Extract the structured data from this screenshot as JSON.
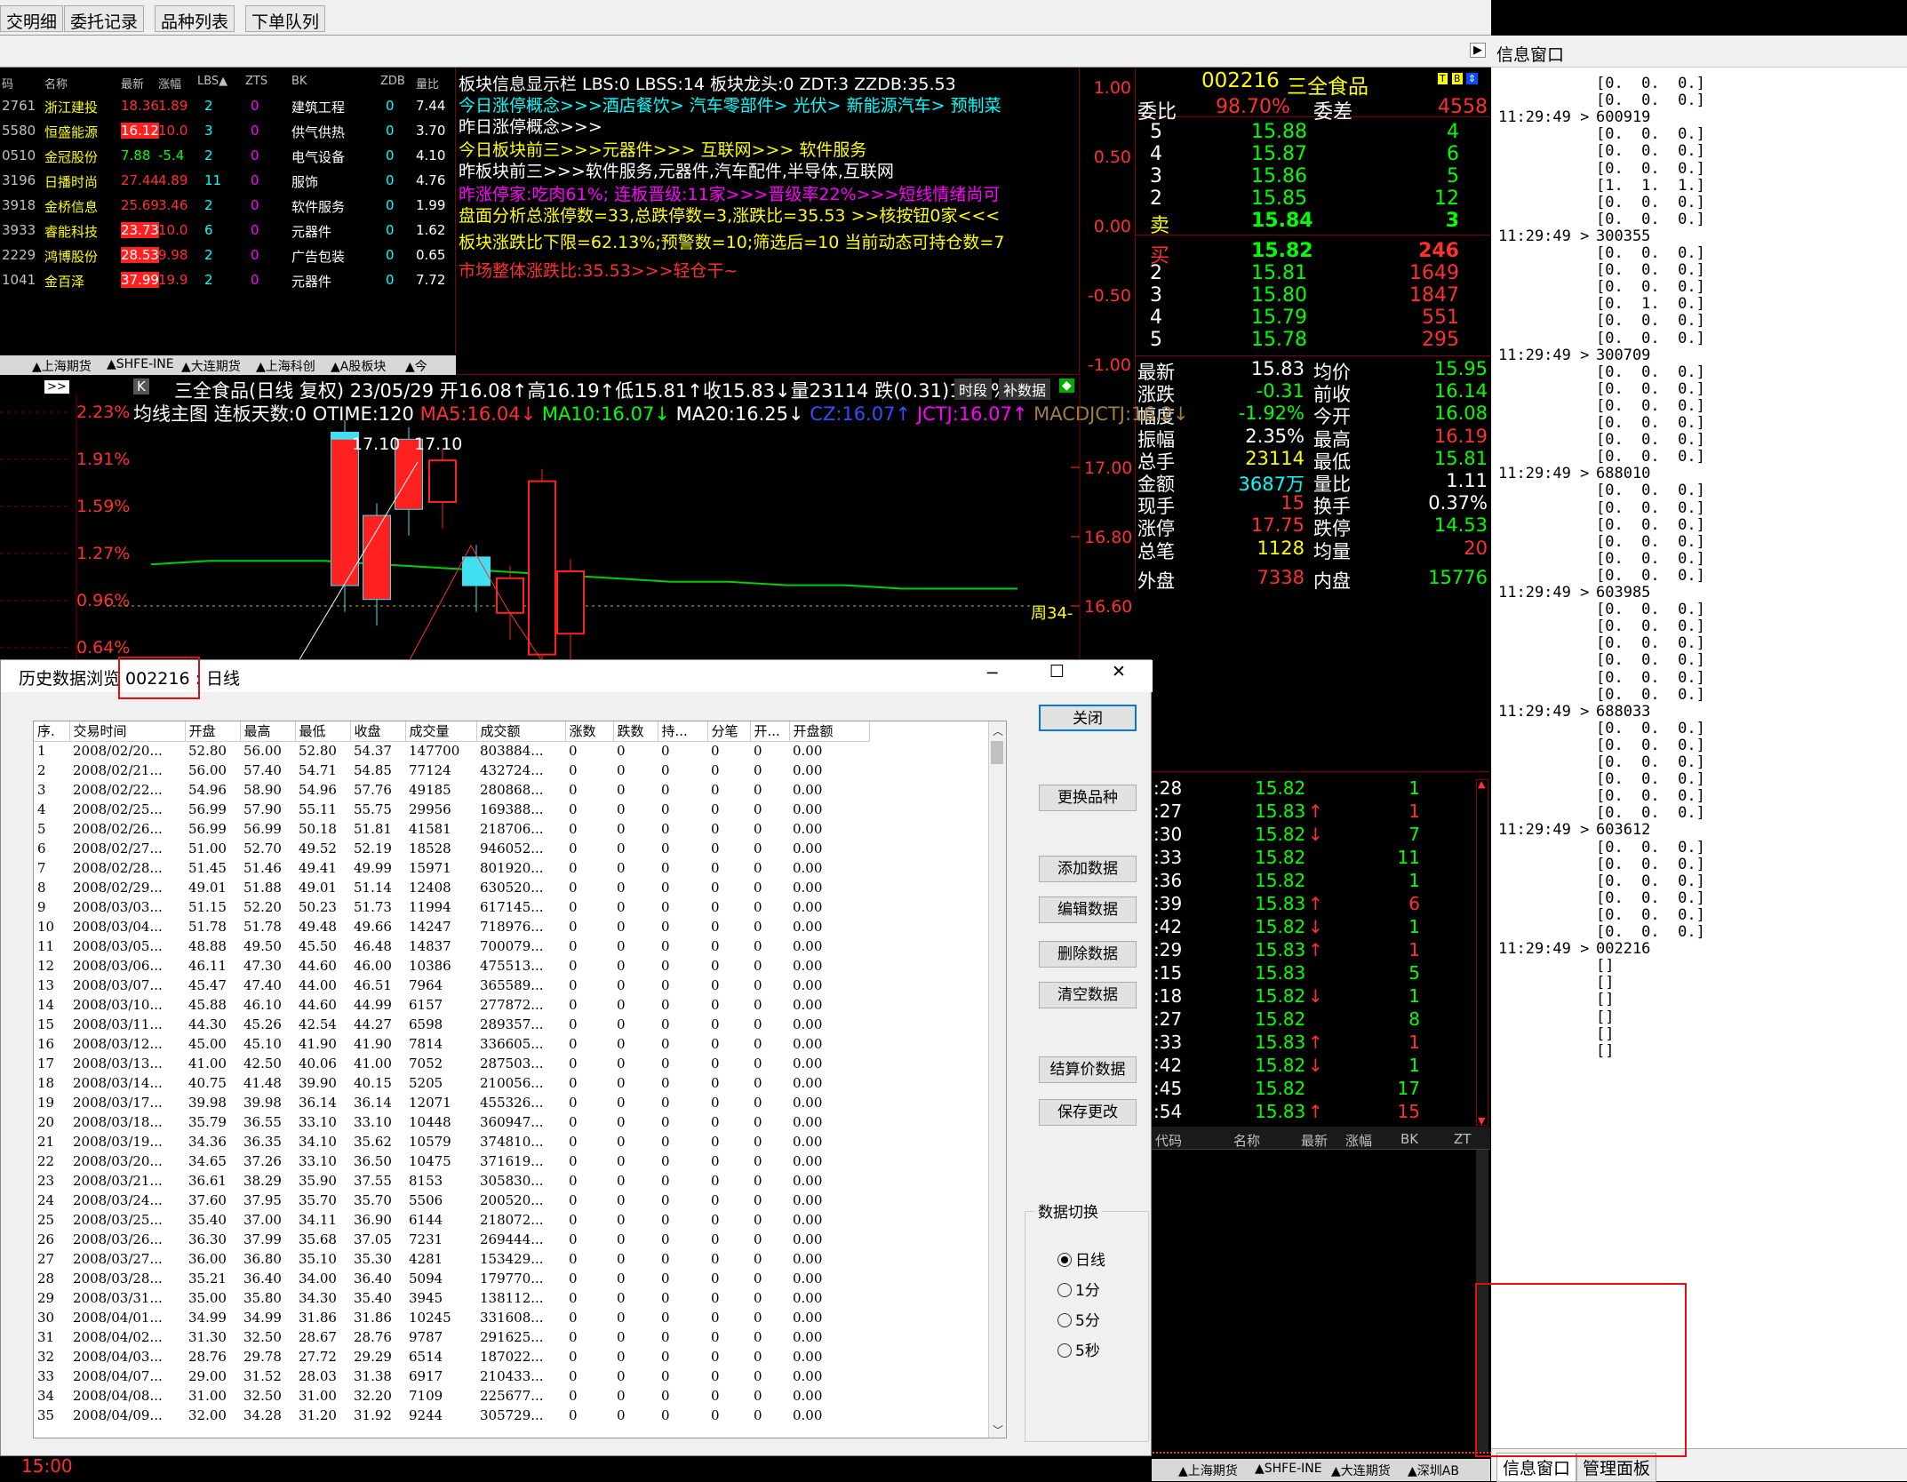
{
  "top_tabs": [
    "交明细",
    "委托记录",
    "品种列表",
    "下单队列"
  ],
  "info_window": {
    "title": "信息窗口",
    "bottom_tabs": [
      "信息窗口",
      "管理面板"
    ],
    "lines": [
      [
        "",
        "[0.  0.  0.]"
      ],
      [
        "",
        "[0.  0.  0.]"
      ],
      [
        "11:29:49 >",
        "600919"
      ],
      [
        "",
        "[0.  0.  0.]"
      ],
      [
        "",
        "[0.  0.  0.]"
      ],
      [
        "",
        "[0.  0.  0.]"
      ],
      [
        "",
        "[1.  1.  1.]"
      ],
      [
        "",
        "[0.  0.  0.]"
      ],
      [
        "",
        "[0.  0.  0.]"
      ],
      [
        "11:29:49 >",
        "300355"
      ],
      [
        "",
        "[0.  0.  0.]"
      ],
      [
        "",
        "[0.  0.  0.]"
      ],
      [
        "",
        "[0.  0.  0.]"
      ],
      [
        "",
        "[0.  1.  0.]"
      ],
      [
        "",
        "[0.  0.  0.]"
      ],
      [
        "",
        "[0.  0.  0.]"
      ],
      [
        "11:29:49 >",
        "300709"
      ],
      [
        "",
        "[0.  0.  0.]"
      ],
      [
        "",
        "[0.  0.  0.]"
      ],
      [
        "",
        "[0.  0.  0.]"
      ],
      [
        "",
        "[0.  0.  0.]"
      ],
      [
        "",
        "[0.  0.  0.]"
      ],
      [
        "",
        "[0.  0.  0.]"
      ],
      [
        "11:29:49 >",
        "688010"
      ],
      [
        "",
        "[0.  0.  0.]"
      ],
      [
        "",
        "[0.  0.  0.]"
      ],
      [
        "",
        "[0.  0.  0.]"
      ],
      [
        "",
        "[0.  0.  0.]"
      ],
      [
        "",
        "[0.  0.  0.]"
      ],
      [
        "",
        "[0.  0.  0.]"
      ],
      [
        "11:29:49 >",
        "603985"
      ],
      [
        "",
        "[0.  0.  0.]"
      ],
      [
        "",
        "[0.  0.  0.]"
      ],
      [
        "",
        "[0.  0.  0.]"
      ],
      [
        "",
        "[0.  0.  0.]"
      ],
      [
        "",
        "[0.  0.  0.]"
      ],
      [
        "",
        "[0.  0.  0.]"
      ],
      [
        "11:29:49 >",
        "688033"
      ],
      [
        "",
        "[0.  0.  0.]"
      ],
      [
        "",
        "[0.  0.  0.]"
      ],
      [
        "",
        "[0.  0.  0.]"
      ],
      [
        "",
        "[0.  0.  0.]"
      ],
      [
        "",
        "[0.  0.  0.]"
      ],
      [
        "",
        "[0.  0.  0.]"
      ],
      [
        "11:29:49 >",
        "603612"
      ],
      [
        "",
        "[0.  0.  0.]"
      ],
      [
        "",
        "[0.  0.  0.]"
      ],
      [
        "",
        "[0.  0.  0.]"
      ],
      [
        "",
        "[0.  0.  0.]"
      ],
      [
        "",
        "[0.  0.  0.]"
      ],
      [
        "",
        "[0.  0.  0.]"
      ],
      [
        "11:29:49 >",
        "002216"
      ],
      [
        "",
        "[]"
      ],
      [
        "",
        "[]"
      ],
      [
        "",
        "[]"
      ],
      [
        "",
        "[]"
      ],
      [
        "",
        "[]"
      ],
      [
        "",
        "[]"
      ]
    ]
  },
  "stock_list": {
    "headers": [
      "码",
      "名称",
      "最新",
      "涨幅",
      "LBS▲",
      "ZTS",
      "BK",
      "ZDB",
      "量比"
    ],
    "rows": [
      [
        "2761",
        "浙江建投",
        "18.36",
        "1.89",
        "2",
        "0",
        "建筑工程",
        "0",
        "7.44"
      ],
      [
        "5580",
        "恒盛能源",
        "16.12",
        "10.0",
        "3",
        "0",
        "供气供热",
        "0",
        "3.70"
      ],
      [
        "0510",
        "金冠股份",
        "7.88",
        "-5.4",
        "2",
        "0",
        "电气设备",
        "0",
        "4.10"
      ],
      [
        "3196",
        "日播时尚",
        "27.44",
        "4.89",
        "11",
        "0",
        "服饰",
        "0",
        "4.76"
      ],
      [
        "3918",
        "金桥信息",
        "25.69",
        "3.46",
        "2",
        "0",
        "软件服务",
        "0",
        "1.99"
      ],
      [
        "3933",
        "睿能科技",
        "23.73",
        "10.0",
        "6",
        "0",
        "元器件",
        "0",
        "1.62"
      ],
      [
        "2229",
        "鸿博股份",
        "28.53",
        "9.98",
        "2",
        "0",
        "广告包装",
        "0",
        "0.65"
      ],
      [
        "1041",
        "金百泽",
        "37.99",
        "19.9",
        "2",
        "0",
        "元器件",
        "0",
        "7.72"
      ]
    ],
    "tabs": [
      "▲上海期货",
      "▲SHFE-INE",
      "▲大连期货",
      "▲上海科创",
      "▲A股板块",
      "▲今"
    ]
  },
  "sector_panel": {
    "lines": [
      {
        "t": "板块信息显示栏 LBS:0 LBSS:14 板块龙头:0 ZDT:3 ZZDB:35.53",
        "c": "#fff"
      },
      {
        "t": "今日涨停概念>>>酒店餐饮> 汽车零部件> 光伏> 新能源汽车> 预制菜",
        "c": "#00ffff"
      },
      {
        "t": "昨日涨停概念>>>",
        "c": "#fff"
      },
      {
        "t": "今日板块前三>>>元器件>>> 互联网>>> 软件服务",
        "c": "#ffff00"
      },
      {
        "t": "昨板块前三>>>软件服务,元器件,汽车配件,半导体,互联网",
        "c": "#fff"
      },
      {
        "t": "昨涨停家:吃肉61%;  连板晋级:11家>>>晋级率22%>>>短线情绪尚可",
        "c": "#ff00ff"
      },
      {
        "t": "盘面分析总涨停数=33,总跌停数=3,涨跌比=35.53 >>核按钮0家<<<",
        "c": "#ffff00"
      },
      {
        "t": "板块涨跌比下限=62.13%;预警数=10;筛选后=10  当前动态可持仓数=7",
        "c": "#ffff00"
      },
      {
        "t": "市场整体涨跌比:35.53>>>轻仓干~",
        "c": "#ff3030"
      }
    ],
    "axis": [
      "1.00",
      "0.50",
      "0.00",
      "-0.50",
      "-1.00"
    ]
  },
  "quote": {
    "code": "002216",
    "name": "三全食品",
    "weibi_label": "委比",
    "weibi": "98.70%",
    "weicha_label": "委差",
    "weicha": "4558",
    "asks": [
      [
        "5",
        "15.88",
        "4"
      ],
      [
        "4",
        "15.87",
        "6"
      ],
      [
        "3",
        "15.86",
        "5"
      ],
      [
        "2",
        "15.85",
        "12"
      ],
      [
        "卖",
        "15.84",
        "3"
      ]
    ],
    "bids": [
      [
        "买",
        "15.82",
        "246"
      ],
      [
        "2",
        "15.81",
        "1649"
      ],
      [
        "3",
        "15.80",
        "1847"
      ],
      [
        "4",
        "15.79",
        "551"
      ],
      [
        "5",
        "15.78",
        "295"
      ]
    ],
    "stats": [
      [
        "最新",
        "15.83",
        "均价",
        "15.95"
      ],
      [
        "涨跌",
        "-0.31",
        "前收",
        "16.14"
      ],
      [
        "幅度",
        "-1.92%",
        "今开",
        "16.08"
      ],
      [
        "振幅",
        "2.35%",
        "最高",
        "16.19"
      ],
      [
        "总手",
        "23114",
        "最低",
        "15.81"
      ],
      [
        "金额",
        "3687万",
        "量比",
        "1.11"
      ],
      [
        "现手",
        "15",
        "换手",
        "0.37%"
      ],
      [
        "涨停",
        "17.75",
        "跌停",
        "14.53"
      ],
      [
        "总笔",
        "1128",
        "均量",
        "20"
      ],
      [
        "外盘",
        "7338",
        "内盘",
        "15776"
      ]
    ]
  },
  "ticks": [
    [
      ":28",
      "15.82",
      "",
      "1"
    ],
    [
      ":27",
      "15.83",
      "↑",
      "1"
    ],
    [
      ":30",
      "15.82",
      "↓",
      "7"
    ],
    [
      ":33",
      "15.82",
      "",
      "11"
    ],
    [
      ":36",
      "15.82",
      "",
      "1"
    ],
    [
      ":39",
      "15.83",
      "↑",
      "6"
    ],
    [
      ":42",
      "15.82",
      "↓",
      "1"
    ],
    [
      ":29",
      "15.83",
      "↑",
      "1"
    ],
    [
      ":15",
      "15.83",
      "",
      "5"
    ],
    [
      ":18",
      "15.82",
      "↓",
      "1"
    ],
    [
      ":27",
      "15.82",
      "",
      "8"
    ],
    [
      ":33",
      "15.83",
      "↑",
      "1"
    ],
    [
      ":42",
      "15.82",
      "↓",
      "1"
    ],
    [
      ":45",
      "15.82",
      "",
      "17"
    ],
    [
      ":54",
      "15.83",
      "↑",
      "15"
    ]
  ],
  "mini_list": {
    "headers": [
      "代码",
      "名称",
      "最新",
      "涨幅",
      "BK",
      "ZT"
    ],
    "tabs": [
      "▲上海期货",
      "▲SHFE-INE",
      "▲大连期货",
      "▲深圳AB"
    ]
  },
  "kline": {
    "info1": "三全食品(日线 复权) 23/05/29 开16.08↑高16.19↑低15.81↑收15.83↓量23114 跌(0.31)1.92%",
    "info2a": "均线主图 连板天数:0 OTIME:120",
    "ma5": "MA5:16.04↓",
    "ma10": "MA10:16.07↓",
    "ma20": "MA20:16.25↓",
    "cz": "CZ:16.07↑",
    "jctj": "JCTJ:16.07↑",
    "macd": "MACDJCTJ:16.2↓",
    "btn_period": "时段",
    "btn_fill": "补数据",
    "arrow": ">>",
    "k": "K",
    "left_axis": [
      "2.23%",
      "1.91%",
      "1.59%",
      "1.27%",
      "0.96%",
      "0.64%"
    ],
    "right_axis": [
      "17.00",
      "16.80",
      "16.60"
    ],
    "peak_labels": [
      "17.10",
      "17.10"
    ],
    "week": "周34-",
    "time": "15:00"
  },
  "chart_data": {
    "type": "candlestick",
    "title": "三全食品(日线 复权)",
    "candles": [
      {
        "o": 17.1,
        "c": 16.66
      },
      {
        "o": 16.86,
        "c": 16.62
      },
      {
        "o": 17.08,
        "c": 16.88
      },
      {
        "o": 16.9,
        "c": 17.02
      },
      {
        "o": 16.74,
        "c": 16.66
      },
      {
        "o": 16.58,
        "c": 16.68
      },
      {
        "o": 16.46,
        "c": 16.96
      },
      {
        "o": 16.52,
        "c": 16.7
      }
    ],
    "ma_line": [
      16.72,
      16.73,
      16.73,
      16.73,
      16.72,
      16.71,
      16.7,
      16.69,
      16.68,
      16.67,
      16.67,
      16.66,
      16.66,
      16.65,
      16.65,
      16.65
    ]
  },
  "dialog": {
    "title": "历史数据浏览 002216 : 日线",
    "min": "─",
    "max": "☐",
    "close": "✕",
    "columns": [
      "序.",
      "交易时间",
      "开盘",
      "最高",
      "最低",
      "收盘",
      "成交量",
      "成交额",
      "涨数",
      "跌数",
      "持...",
      "分笔",
      "开...",
      "开盘额"
    ],
    "rows": [
      [
        "1",
        "2008/02/20...",
        "52.80",
        "56.00",
        "52.80",
        "54.37",
        "147700",
        "803884...",
        "0",
        "0",
        "0",
        "0",
        "0",
        "0.00"
      ],
      [
        "2",
        "2008/02/21...",
        "56.00",
        "57.40",
        "54.71",
        "54.85",
        "77124",
        "432724...",
        "0",
        "0",
        "0",
        "0",
        "0",
        "0.00"
      ],
      [
        "3",
        "2008/02/22...",
        "54.96",
        "58.90",
        "54.96",
        "57.76",
        "49185",
        "280868...",
        "0",
        "0",
        "0",
        "0",
        "0",
        "0.00"
      ],
      [
        "4",
        "2008/02/25...",
        "56.99",
        "57.90",
        "55.11",
        "55.75",
        "29956",
        "169388...",
        "0",
        "0",
        "0",
        "0",
        "0",
        "0.00"
      ],
      [
        "5",
        "2008/02/26...",
        "56.99",
        "56.99",
        "50.18",
        "51.81",
        "41581",
        "218706...",
        "0",
        "0",
        "0",
        "0",
        "0",
        "0.00"
      ],
      [
        "6",
        "2008/02/27...",
        "51.00",
        "52.70",
        "49.52",
        "52.19",
        "18528",
        "946052...",
        "0",
        "0",
        "0",
        "0",
        "0",
        "0.00"
      ],
      [
        "7",
        "2008/02/28...",
        "51.45",
        "51.46",
        "49.41",
        "49.99",
        "15971",
        "801920...",
        "0",
        "0",
        "0",
        "0",
        "0",
        "0.00"
      ],
      [
        "8",
        "2008/02/29...",
        "49.01",
        "51.88",
        "49.01",
        "51.14",
        "12408",
        "630520...",
        "0",
        "0",
        "0",
        "0",
        "0",
        "0.00"
      ],
      [
        "9",
        "2008/03/03...",
        "51.15",
        "52.20",
        "50.23",
        "51.73",
        "11994",
        "617145...",
        "0",
        "0",
        "0",
        "0",
        "0",
        "0.00"
      ],
      [
        "10",
        "2008/03/04...",
        "51.78",
        "51.78",
        "49.48",
        "49.66",
        "14247",
        "718976...",
        "0",
        "0",
        "0",
        "0",
        "0",
        "0.00"
      ],
      [
        "11",
        "2008/03/05...",
        "48.88",
        "49.50",
        "45.50",
        "46.48",
        "14837",
        "700079...",
        "0",
        "0",
        "0",
        "0",
        "0",
        "0.00"
      ],
      [
        "12",
        "2008/03/06...",
        "46.11",
        "47.30",
        "44.60",
        "46.00",
        "10386",
        "475513...",
        "0",
        "0",
        "0",
        "0",
        "0",
        "0.00"
      ],
      [
        "13",
        "2008/03/07...",
        "45.47",
        "47.40",
        "44.00",
        "46.51",
        "7964",
        "365589...",
        "0",
        "0",
        "0",
        "0",
        "0",
        "0.00"
      ],
      [
        "14",
        "2008/03/10...",
        "45.88",
        "46.10",
        "44.60",
        "44.99",
        "6157",
        "277872...",
        "0",
        "0",
        "0",
        "0",
        "0",
        "0.00"
      ],
      [
        "15",
        "2008/03/11...",
        "44.30",
        "45.26",
        "42.54",
        "44.27",
        "6598",
        "289357...",
        "0",
        "0",
        "0",
        "0",
        "0",
        "0.00"
      ],
      [
        "16",
        "2008/03/12...",
        "45.00",
        "45.10",
        "41.90",
        "41.90",
        "7814",
        "336605...",
        "0",
        "0",
        "0",
        "0",
        "0",
        "0.00"
      ],
      [
        "17",
        "2008/03/13...",
        "41.00",
        "42.50",
        "40.06",
        "41.00",
        "7052",
        "287503...",
        "0",
        "0",
        "0",
        "0",
        "0",
        "0.00"
      ],
      [
        "18",
        "2008/03/14...",
        "40.75",
        "41.48",
        "39.90",
        "40.15",
        "5205",
        "210056...",
        "0",
        "0",
        "0",
        "0",
        "0",
        "0.00"
      ],
      [
        "19",
        "2008/03/17...",
        "39.98",
        "39.98",
        "36.14",
        "36.14",
        "12071",
        "455326...",
        "0",
        "0",
        "0",
        "0",
        "0",
        "0.00"
      ],
      [
        "20",
        "2008/03/18...",
        "35.79",
        "36.55",
        "33.10",
        "33.10",
        "10448",
        "360947...",
        "0",
        "0",
        "0",
        "0",
        "0",
        "0.00"
      ],
      [
        "21",
        "2008/03/19...",
        "34.36",
        "36.35",
        "34.10",
        "35.62",
        "10579",
        "374810...",
        "0",
        "0",
        "0",
        "0",
        "0",
        "0.00"
      ],
      [
        "22",
        "2008/03/20...",
        "34.65",
        "37.26",
        "33.10",
        "36.50",
        "10475",
        "371619...",
        "0",
        "0",
        "0",
        "0",
        "0",
        "0.00"
      ],
      [
        "23",
        "2008/03/21...",
        "36.61",
        "38.29",
        "35.90",
        "37.55",
        "8153",
        "305830...",
        "0",
        "0",
        "0",
        "0",
        "0",
        "0.00"
      ],
      [
        "24",
        "2008/03/24...",
        "37.60",
        "37.95",
        "35.70",
        "35.70",
        "5506",
        "200520...",
        "0",
        "0",
        "0",
        "0",
        "0",
        "0.00"
      ],
      [
        "25",
        "2008/03/25...",
        "35.40",
        "37.00",
        "34.11",
        "36.90",
        "6144",
        "218072...",
        "0",
        "0",
        "0",
        "0",
        "0",
        "0.00"
      ],
      [
        "26",
        "2008/03/26...",
        "36.30",
        "37.99",
        "35.68",
        "37.05",
        "7231",
        "269444...",
        "0",
        "0",
        "0",
        "0",
        "0",
        "0.00"
      ],
      [
        "27",
        "2008/03/27...",
        "36.00",
        "36.80",
        "35.10",
        "35.30",
        "4281",
        "153429...",
        "0",
        "0",
        "0",
        "0",
        "0",
        "0.00"
      ],
      [
        "28",
        "2008/03/28...",
        "35.21",
        "36.40",
        "34.00",
        "36.40",
        "5094",
        "179770...",
        "0",
        "0",
        "0",
        "0",
        "0",
        "0.00"
      ],
      [
        "29",
        "2008/03/31...",
        "35.00",
        "35.80",
        "34.30",
        "35.40",
        "3945",
        "138112...",
        "0",
        "0",
        "0",
        "0",
        "0",
        "0.00"
      ],
      [
        "30",
        "2008/04/01...",
        "34.99",
        "34.99",
        "31.86",
        "31.86",
        "10245",
        "331608...",
        "0",
        "0",
        "0",
        "0",
        "0",
        "0.00"
      ],
      [
        "31",
        "2008/04/02...",
        "31.30",
        "32.50",
        "28.67",
        "28.76",
        "9787",
        "291625...",
        "0",
        "0",
        "0",
        "0",
        "0",
        "0.00"
      ],
      [
        "32",
        "2008/04/03...",
        "28.76",
        "29.78",
        "27.72",
        "29.29",
        "6514",
        "187022...",
        "0",
        "0",
        "0",
        "0",
        "0",
        "0.00"
      ],
      [
        "33",
        "2008/04/07...",
        "29.00",
        "31.52",
        "28.03",
        "31.38",
        "6917",
        "210433...",
        "0",
        "0",
        "0",
        "0",
        "0",
        "0.00"
      ],
      [
        "34",
        "2008/04/08...",
        "31.00",
        "32.50",
        "31.00",
        "32.20",
        "7109",
        "225677...",
        "0",
        "0",
        "0",
        "0",
        "0",
        "0.00"
      ],
      [
        "35",
        "2008/04/09...",
        "32.00",
        "34.28",
        "31.20",
        "31.92",
        "9244",
        "305729...",
        "0",
        "0",
        "0",
        "0",
        "0",
        "0.00"
      ]
    ],
    "buttons": [
      "关闭",
      "更换品种",
      "添加数据",
      "编辑数据",
      "删除数据",
      "清空数据",
      "结算价数据",
      "保存更改"
    ],
    "switch_title": "数据切换",
    "switch_options": [
      "日线",
      "1分",
      "5分",
      "5秒"
    ],
    "switch_selected": "日线"
  }
}
